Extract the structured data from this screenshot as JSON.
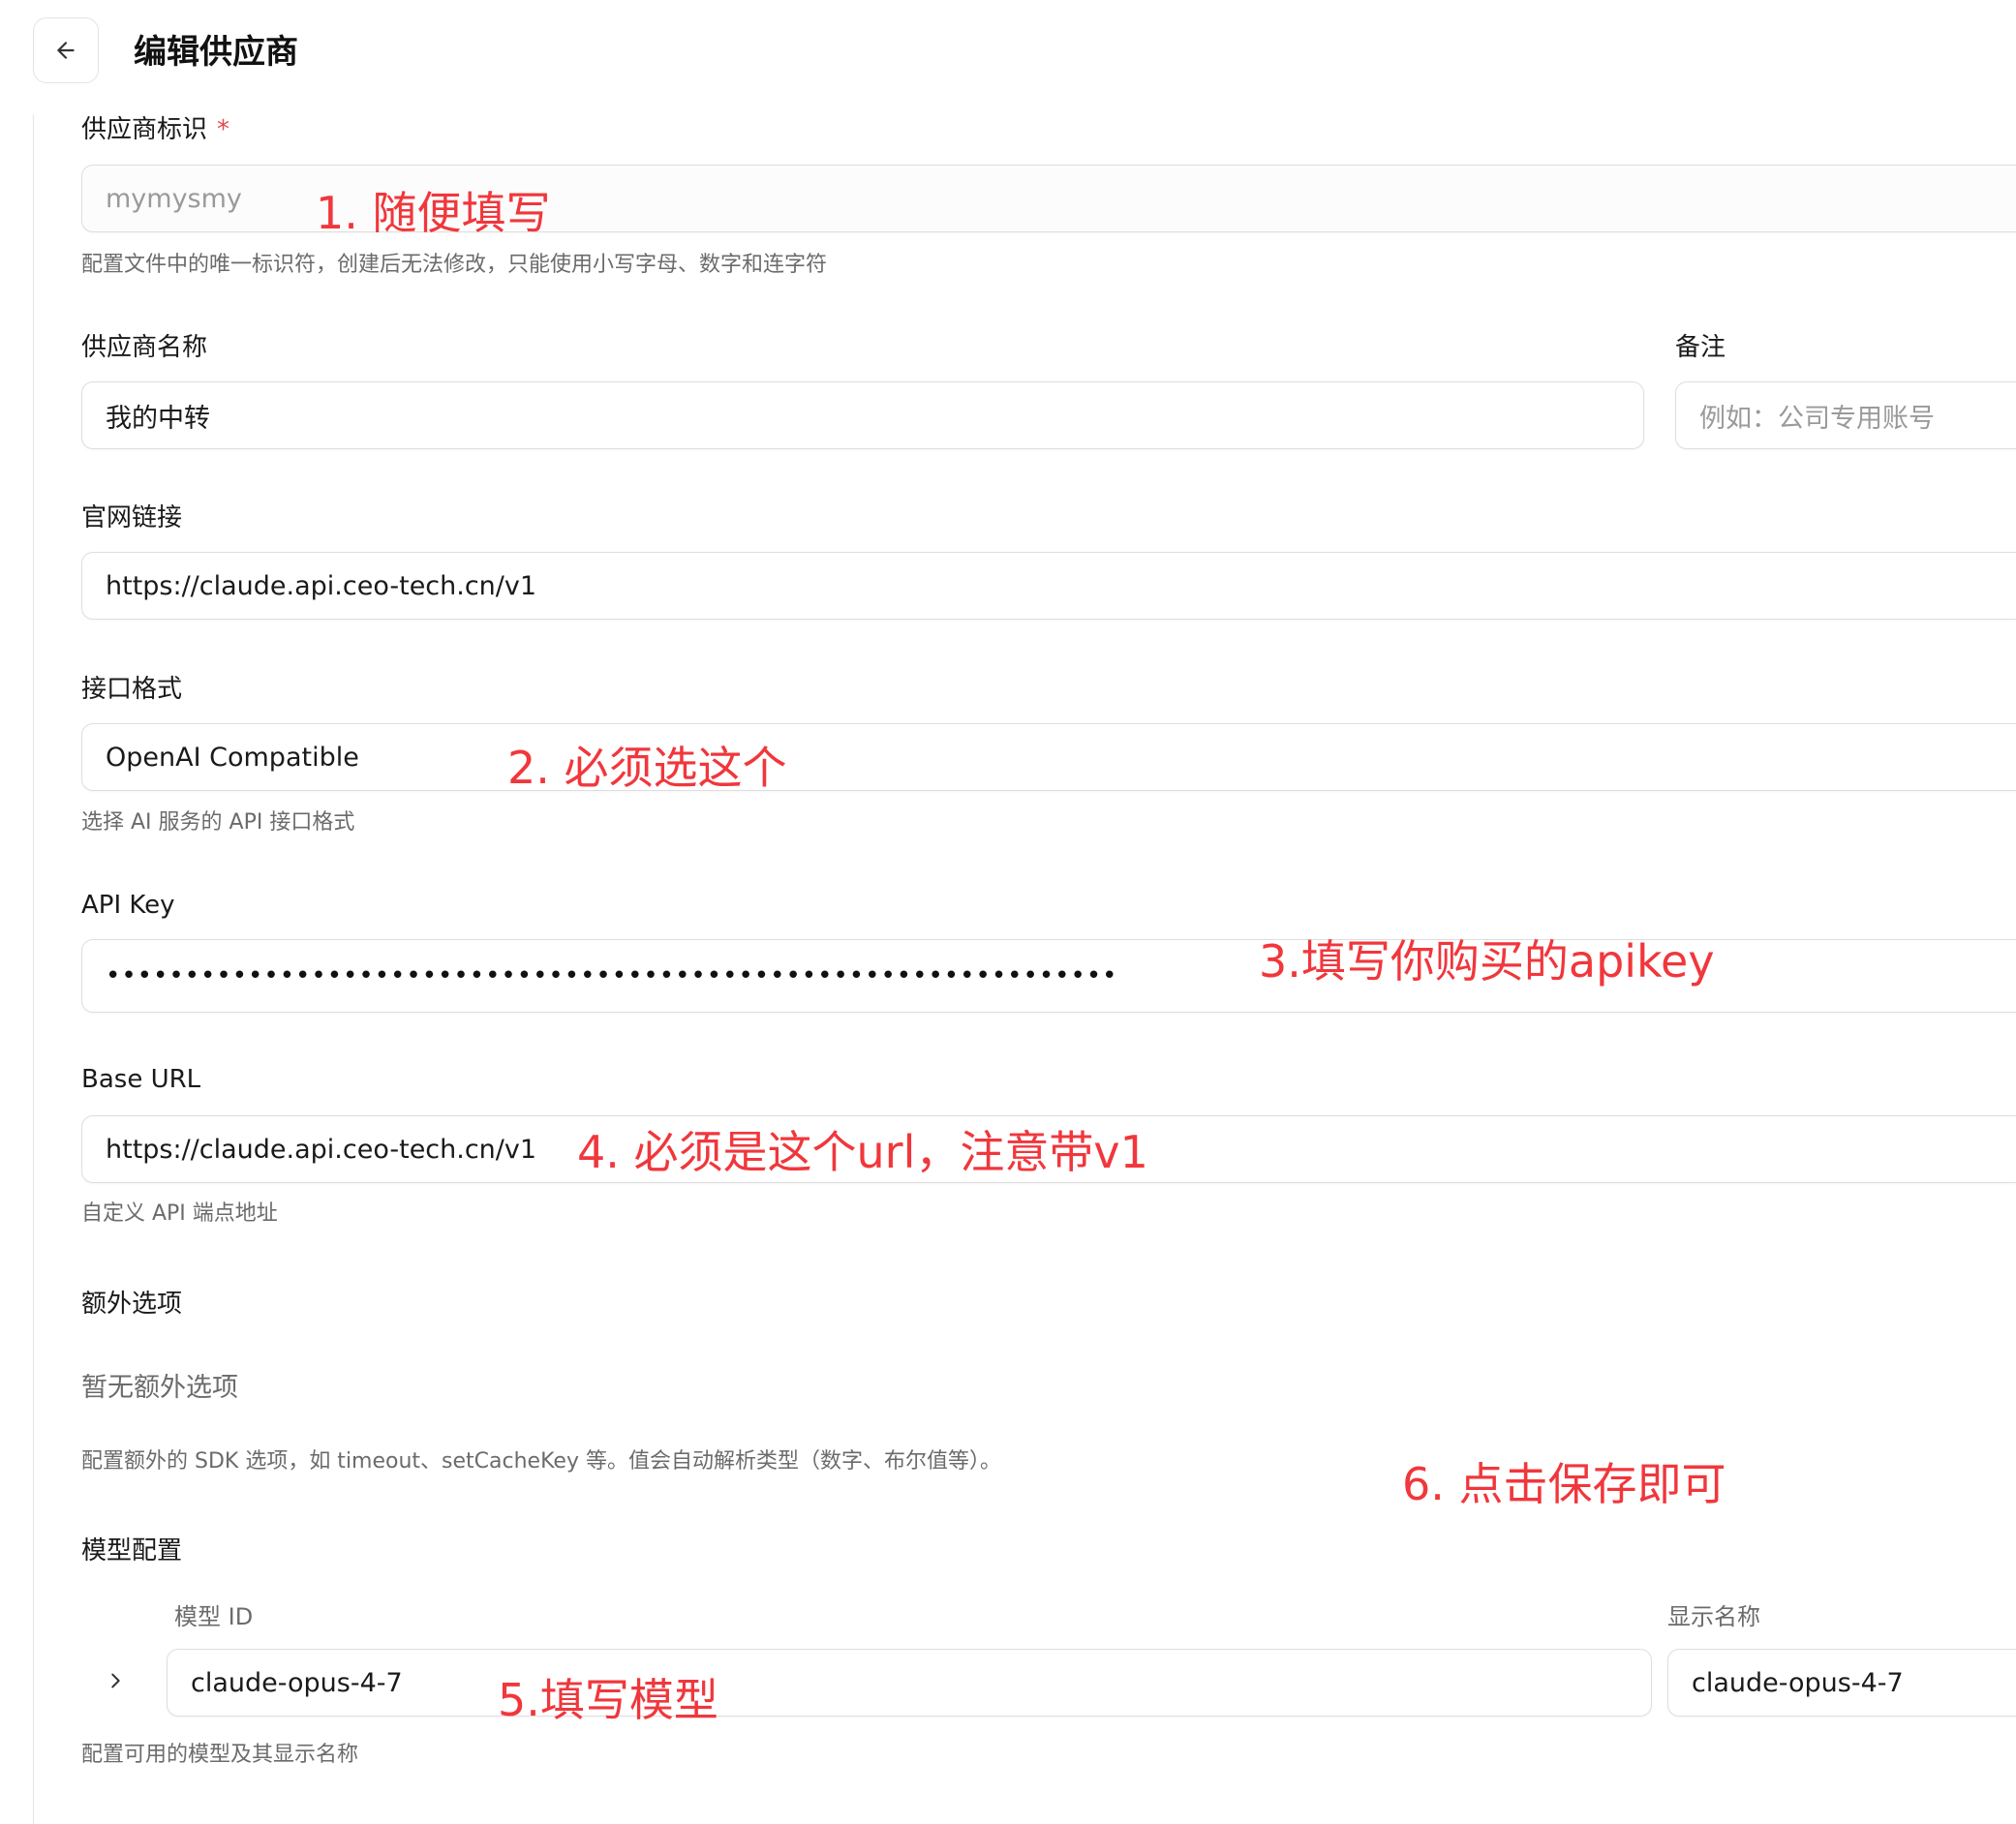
{
  "header": {
    "title": "编辑供应商"
  },
  "form": {
    "provider_id": {
      "label": "供应商标识",
      "required_mark": "*",
      "value": "mymysmy",
      "help": "配置文件中的唯一标识符，创建后无法修改，只能使用小写字母、数字和连字符"
    },
    "provider_name": {
      "label": "供应商名称",
      "value": "我的中转"
    },
    "note": {
      "label": "备注",
      "placeholder": "例如：公司专用账号"
    },
    "website": {
      "label": "官网链接",
      "value": "https://claude.api.ceo-tech.cn/v1"
    },
    "api_format": {
      "label": "接口格式",
      "value": "OpenAI Compatible",
      "help": "选择 AI 服务的 API 接口格式"
    },
    "api_key": {
      "label": "API Key",
      "masked_value": "••••••••••••••••••••••••••••••••••••••••••••••••••••••••••••••••"
    },
    "base_url": {
      "label": "Base URL",
      "value": "https://claude.api.ceo-tech.cn/v1",
      "help": "自定义 API 端点地址"
    },
    "extra_options": {
      "label": "额外选项",
      "empty": "暂无额外选项",
      "help": "配置额外的 SDK 选项，如 timeout、setCacheKey 等。值会自动解析类型（数字、布尔值等）。"
    },
    "models": {
      "label": "模型配置",
      "col_id": "模型 ID",
      "col_name": "显示名称",
      "rows": [
        {
          "id": "claude-opus-4-7",
          "name": "claude-opus-4-7"
        }
      ],
      "help": "配置可用的模型及其显示名称"
    }
  },
  "annotations": {
    "color": "#f0373c",
    "step1": "1. 随便填写",
    "step2": "2. 必须选这个",
    "step3": "3.填写你购买的apikey",
    "step4": "4. 必须是这个url，注意带v1",
    "step5": "5.填写模型",
    "step6": "6. 点击保存即可"
  },
  "icons": {
    "back": "arrow-left-icon",
    "expand": "chevron-right-icon"
  }
}
